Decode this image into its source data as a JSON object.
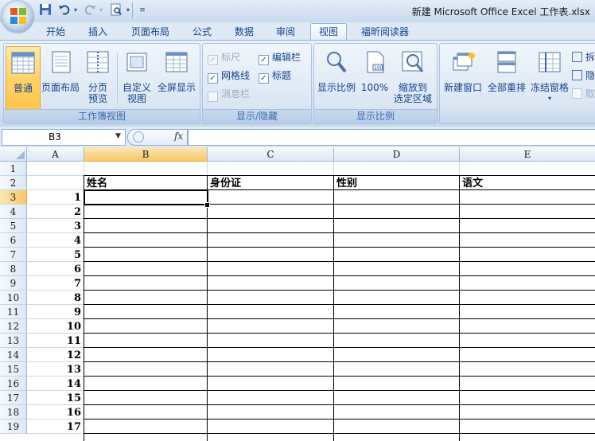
{
  "window": {
    "title": "新建 Microsoft Office Excel 工作表.xlsx"
  },
  "quick_access": {
    "save_icon": "save-icon",
    "undo_icon": "undo-icon",
    "redo_icon": "redo-icon",
    "print_preview_icon": "print-preview-icon"
  },
  "tabs": [
    {
      "label": "开始"
    },
    {
      "label": "插入"
    },
    {
      "label": "页面布局"
    },
    {
      "label": "公式"
    },
    {
      "label": "数据"
    },
    {
      "label": "审阅"
    },
    {
      "label": "视图",
      "active": true
    },
    {
      "label": "福昕阅读器"
    }
  ],
  "ribbon": {
    "workbook_views": {
      "label": "工作簿视图",
      "normal": "普通",
      "page_layout": "页面布局",
      "page_break_line1": "分页",
      "page_break_line2": "预览",
      "custom_line1": "自定义",
      "custom_line2": "视图",
      "fullscreen": "全屏显示"
    },
    "show_hide": {
      "label": "显示/隐藏",
      "ruler": "标尺",
      "gridlines": "网格线",
      "message_bar": "消息栏",
      "formula_bar": "编辑栏",
      "headings": "标题"
    },
    "zoom": {
      "label": "显示比例",
      "zoom": "显示比例",
      "hundred": "100%",
      "zoom_sel_line1": "缩放到",
      "zoom_sel_line2": "选定区域"
    },
    "window": {
      "new_window": "新建窗口",
      "arrange_all": "全部重排",
      "freeze_panes": "冻结窗格",
      "split": "拆",
      "hide": "隐",
      "unhide": "取"
    }
  },
  "formula_bar": {
    "name_box": "B3",
    "fx": "fx",
    "value": ""
  },
  "sheet": {
    "columns": [
      "A",
      "B",
      "C",
      "D",
      "E"
    ],
    "selected_column": "B",
    "selected_row": "3",
    "rows": [
      "1",
      "2",
      "3",
      "4",
      "5",
      "6",
      "7",
      "8",
      "9",
      "10",
      "11",
      "12",
      "13",
      "14",
      "15",
      "16",
      "17",
      "18"
    ],
    "header_row": [
      "姓名",
      "身份证",
      "性别",
      "语文"
    ],
    "col_a_values": [
      "1",
      "2",
      "3",
      "4",
      "5",
      "6",
      "7",
      "8",
      "9",
      "10",
      "11",
      "12",
      "13",
      "14",
      "15",
      "16",
      "17"
    ]
  },
  "colors": {
    "accent": "#15428b",
    "selection": "#f6c765"
  }
}
